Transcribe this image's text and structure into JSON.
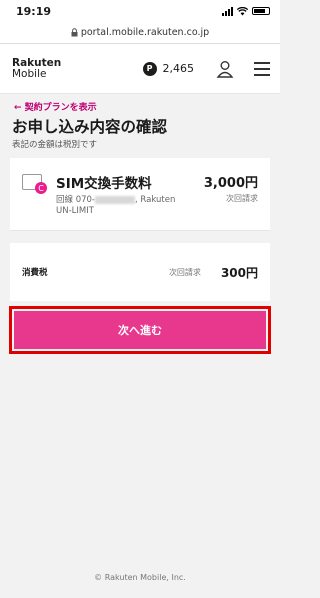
{
  "status_bar": {
    "time": "19:19"
  },
  "browser": {
    "url": "portal.mobile.rakuten.co.jp"
  },
  "header": {
    "logo_line1": "Rakuten",
    "logo_line2": "Mobile",
    "points": "2,465"
  },
  "back_link": "← 契約プランを表示",
  "page_title": "お申し込み内容の確認",
  "subtitle": "表記の金額は税別です",
  "item": {
    "name": "SIM交換手数料",
    "line_prefix": "回線 070-",
    "line_suffix": ", Rakuten",
    "line_plan": "UN-LIMIT",
    "price": "3,000円",
    "price_note": "次回請求"
  },
  "tax": {
    "label": "消費税",
    "note": "次回請求",
    "price": "300円"
  },
  "next_button": "次へ進む",
  "footer": "© Rakuten Mobile, Inc.",
  "colors": {
    "accent": "#e8388e",
    "highlight": "#e00000",
    "link": "#bf0073"
  }
}
